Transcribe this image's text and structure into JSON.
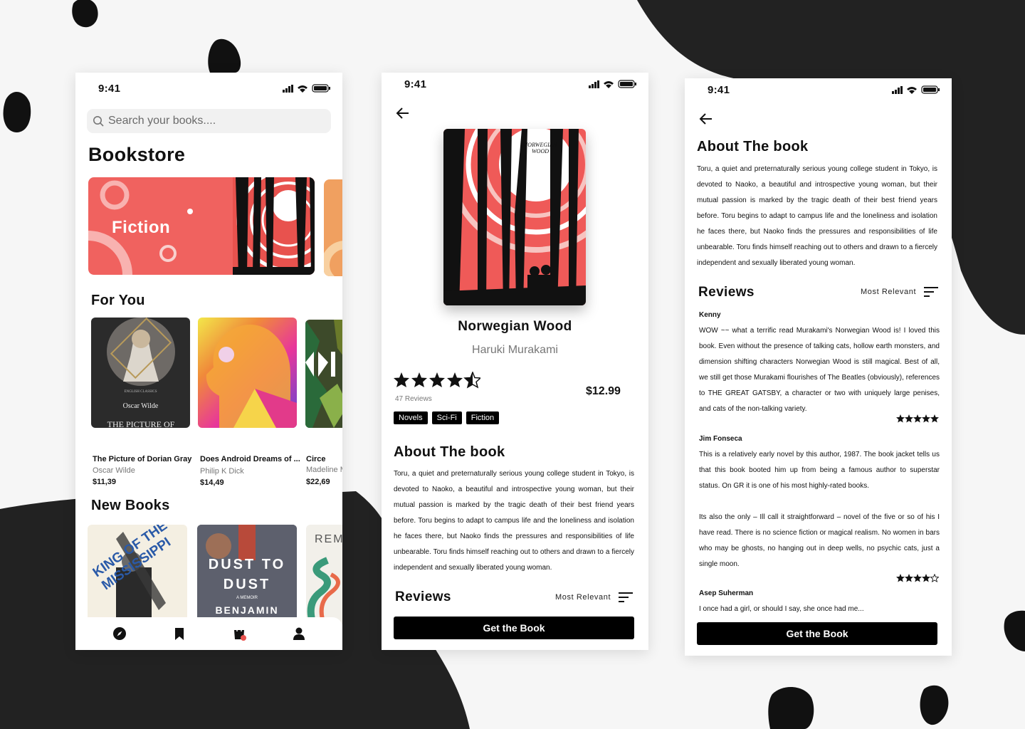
{
  "status": {
    "time": "9:41"
  },
  "home": {
    "search_placeholder": "Search your books....",
    "title": "Bookstore",
    "banner_label": "Fiction",
    "for_you_title": "For You",
    "for_you": [
      {
        "title": "The Picture of Dorian Gray",
        "author": "Oscar Wilde",
        "price": "$11,39",
        "cover_author": "Oscar Wilde",
        "cover_title": "THE PICTURE OF DORIAN GRAY",
        "cover_series": "ENGLISH CLASSICS"
      },
      {
        "title": "Does Android Dreams of ...",
        "author": "Philip K Dick",
        "price": "$14,49"
      },
      {
        "title": "Circe",
        "author": "Madeline M",
        "price": "$22,69"
      }
    ],
    "new_books_title": "New Books",
    "new_books": [
      {
        "cover_text": "KING OF THE MISSISSIPPI"
      },
      {
        "cover_text": "DUST TO DUST",
        "cover_sub": "A MEMOIR",
        "cover_author": "BENJAMIN"
      },
      {
        "cover_text": "REM"
      }
    ],
    "tabs": [
      "explore",
      "bookmarks",
      "cart",
      "profile"
    ],
    "cart_badge": "1"
  },
  "detail": {
    "cover_text": "NORWEGIAN WOOD",
    "title": "Norwegian Wood",
    "author": "Haruki Murakami",
    "rating": 4.5,
    "reviews_count": "47 Reviews",
    "price": "$12.99",
    "tags": [
      "Novels",
      "Sci-Fi",
      "Fiction"
    ],
    "about_title": "About The book",
    "about_text": "Toru, a quiet and preternaturally serious young college student in Tokyo, is devoted to Naoko, a beautiful and introspective young woman, but their mutual passion is marked by the tragic death of their best friend years before. Toru begins to adapt to campus life and the loneliness and isolation he faces there, but Naoko finds the pressures and responsibilities of life unbearable. Toru finds himself reaching out to others and drawn to a fiercely independent and sexually liberated young woman.",
    "reviews_title": "Reviews",
    "sort_label": "Most Relevant",
    "cta": "Get the Book"
  },
  "reviews": {
    "about_title": "About The book",
    "about_text": "Toru, a quiet and preternaturally serious young college student in Tokyo, is devoted to Naoko, a beautiful and introspective young woman, but their mutual passion is marked by the tragic death of their best friend years before. Toru begins to adapt to campus life and the loneliness and isolation he faces there, but Naoko finds the pressures and responsibilities of life unbearable. Toru finds himself reaching out to others and drawn to a fiercely independent and sexually liberated young woman.",
    "reviews_title": "Reviews",
    "sort_label": "Most Relevant",
    "items": [
      {
        "name": "Kenny",
        "text": "WOW ~~ what a terrific read Murakami's Norwegian Wood is! I loved this book. Even without the presence of talking cats, hollow earth monsters, and dimension shifting characters Norwegian Wood is still magical. Best of all, we still get those Murakami flourishes of The Beatles (obviously), references to THE GREAT GATSBY, a character or two with uniquely large penises, and cats of the non-talking variety.",
        "stars": 5
      },
      {
        "name": "Jim Fonseca",
        "text": "This is a relatively early novel by this author, 1987. The book jacket tells us that this book booted him up from being a famous author to superstar status. On GR it is one of his most highly-rated books.",
        "text2": "Its also the only – Ill call it straightforward – novel of the five or so of his I have read. There is no science fiction or magical realism. No women in bars who may be ghosts, no hanging out in deep wells, no psychic cats, just a single moon.",
        "stars": 4
      },
      {
        "name": "Asep Suherman",
        "text": "I once had a girl, or should I say, she once had me...",
        "stars": 0
      }
    ],
    "cta": "Get the Book"
  },
  "colors": {
    "accent": "#f0625f",
    "orange": "#f0a060",
    "black": "#000000"
  }
}
